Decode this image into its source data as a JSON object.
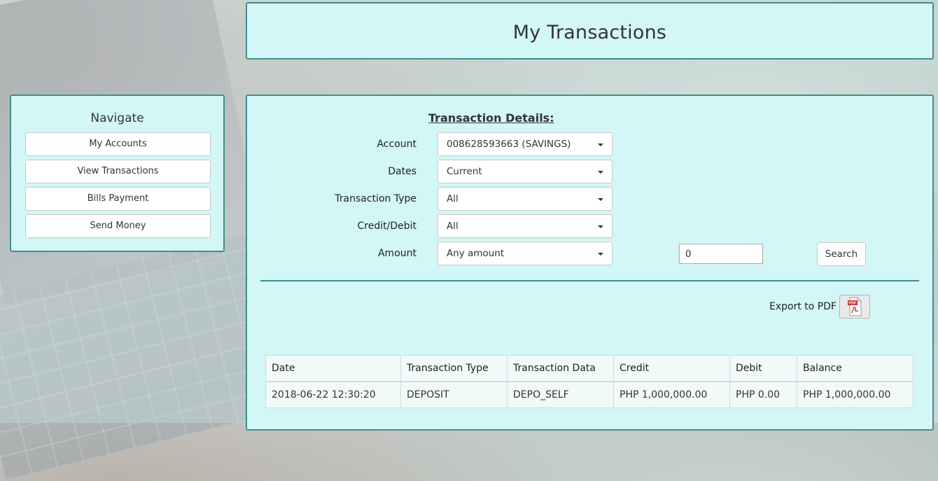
{
  "header": {
    "title": "My Transactions"
  },
  "nav": {
    "title": "Navigate",
    "items": [
      {
        "label": "My Accounts"
      },
      {
        "label": "View Transactions"
      },
      {
        "label": "Bills Payment"
      },
      {
        "label": "Send Money"
      }
    ]
  },
  "form": {
    "section_title": "Transaction Details:",
    "account": {
      "label": "Account",
      "value": "008628593663 (SAVINGS)"
    },
    "dates": {
      "label": "Dates",
      "value": "Current"
    },
    "transaction_type": {
      "label": "Transaction Type",
      "value": "All"
    },
    "credit_debit": {
      "label": "Credit/Debit",
      "value": "All"
    },
    "amount": {
      "label": "Amount",
      "value": "Any amount",
      "input_value": "0"
    },
    "search_label": "Search"
  },
  "export": {
    "label": "Export to PDF",
    "icon": "pdf-icon"
  },
  "table": {
    "columns": [
      "Date",
      "Transaction Type",
      "Transaction Data",
      "Credit",
      "Debit",
      "Balance"
    ],
    "rows": [
      [
        "2018-06-22 12:30:20",
        "DEPOSIT",
        "DEPO_SELF",
        "PHP 1,000,000.00",
        "PHP 0.00",
        "PHP 1,000,000.00"
      ]
    ]
  },
  "colors": {
    "panel_bg": "#d3f6f6",
    "panel_border": "#3f8f8c",
    "pdf_red": "#d22b2b"
  }
}
